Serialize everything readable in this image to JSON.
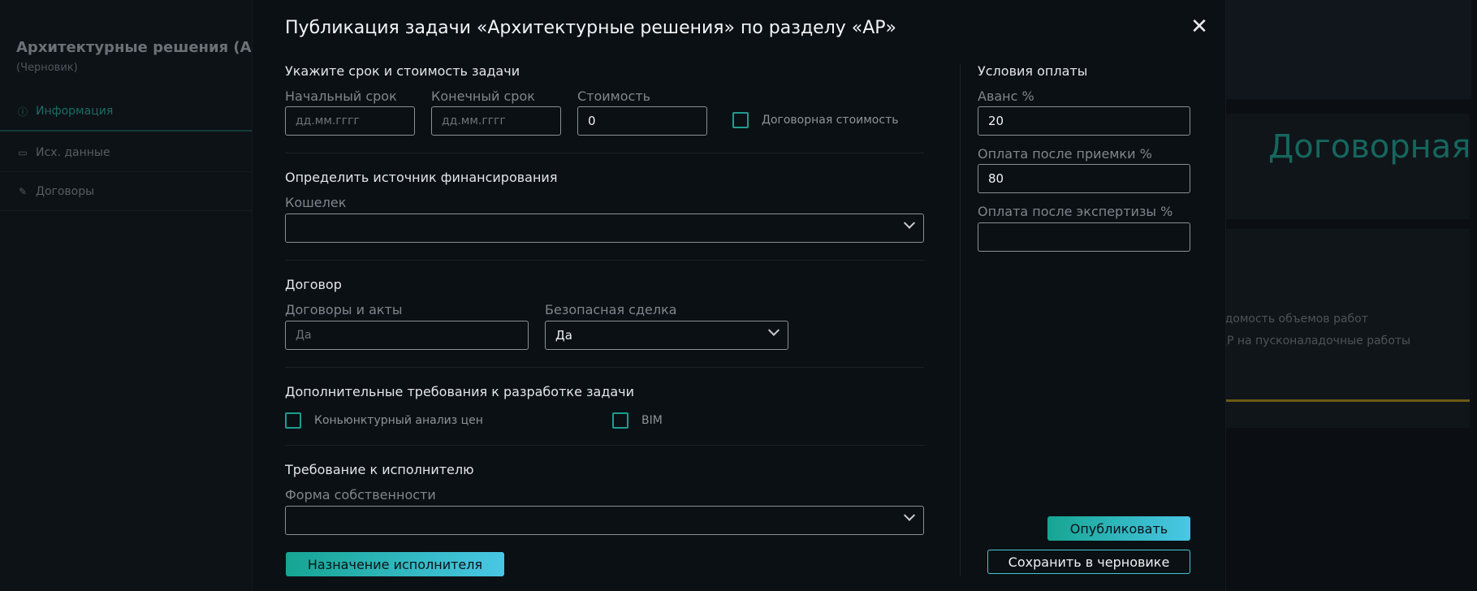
{
  "background": {
    "title": "Архитектурные решения (АР)",
    "subtitle": "(Черновик)",
    "nav": [
      {
        "label": "Информация",
        "icon": "info-icon"
      },
      {
        "label": "Исх. данные",
        "icon": "folder-icon"
      },
      {
        "label": "Договоры",
        "icon": "handshake-icon"
      }
    ],
    "big_text": "Договорная",
    "list_items": [
      "едомость объемов работ",
      "ДР на пусконаладочные работы"
    ]
  },
  "modal": {
    "title": "Публикация задачи «Архитектурные решения» по разделу «АР»",
    "close_icon": "close-icon",
    "deadline_section": {
      "title": "Укажите срок и стоимость задачи",
      "start_label": "Начальный срок",
      "start_placeholder": "дд.мм.гггг",
      "end_label": "Конечный срок",
      "end_placeholder": "дд.мм.гггг",
      "cost_label": "Стоимость",
      "cost_value": "0",
      "negotiable_label": "Договорная стоимость",
      "negotiable_checked": false
    },
    "funding_section": {
      "title": "Определить источник финансирования",
      "wallet_label": "Кошелек",
      "wallet_value": ""
    },
    "contract_section": {
      "title": "Договор",
      "acts_label": "Договоры и акты",
      "acts_placeholder": "Да",
      "safe_deal_label": "Безопасная сделка",
      "safe_deal_value": "Да"
    },
    "extra_section": {
      "title": "Дополнительные требования к разработке задачи",
      "price_analysis_label": "Коньюнктурный анализ цен",
      "bim_label": "BIM"
    },
    "executor_section": {
      "title": "Требование к исполнителю",
      "ownership_label": "Форма собственности",
      "ownership_value": ""
    },
    "assign_button": "Назначение исполнителя",
    "payment": {
      "title": "Условия оплаты",
      "advance_label": "Аванс %",
      "advance_value": "20",
      "after_accept_label": "Оплата после приемки %",
      "after_accept_value": "80",
      "after_expertise_label": "Оплата после экспертизы %",
      "after_expertise_value": ""
    },
    "publish_button": "Опубликовать",
    "save_draft_button": "Сохранить в черновике"
  },
  "colors": {
    "accent": "#16a592",
    "accent2": "#49c7e6",
    "background": "#0b1014"
  }
}
